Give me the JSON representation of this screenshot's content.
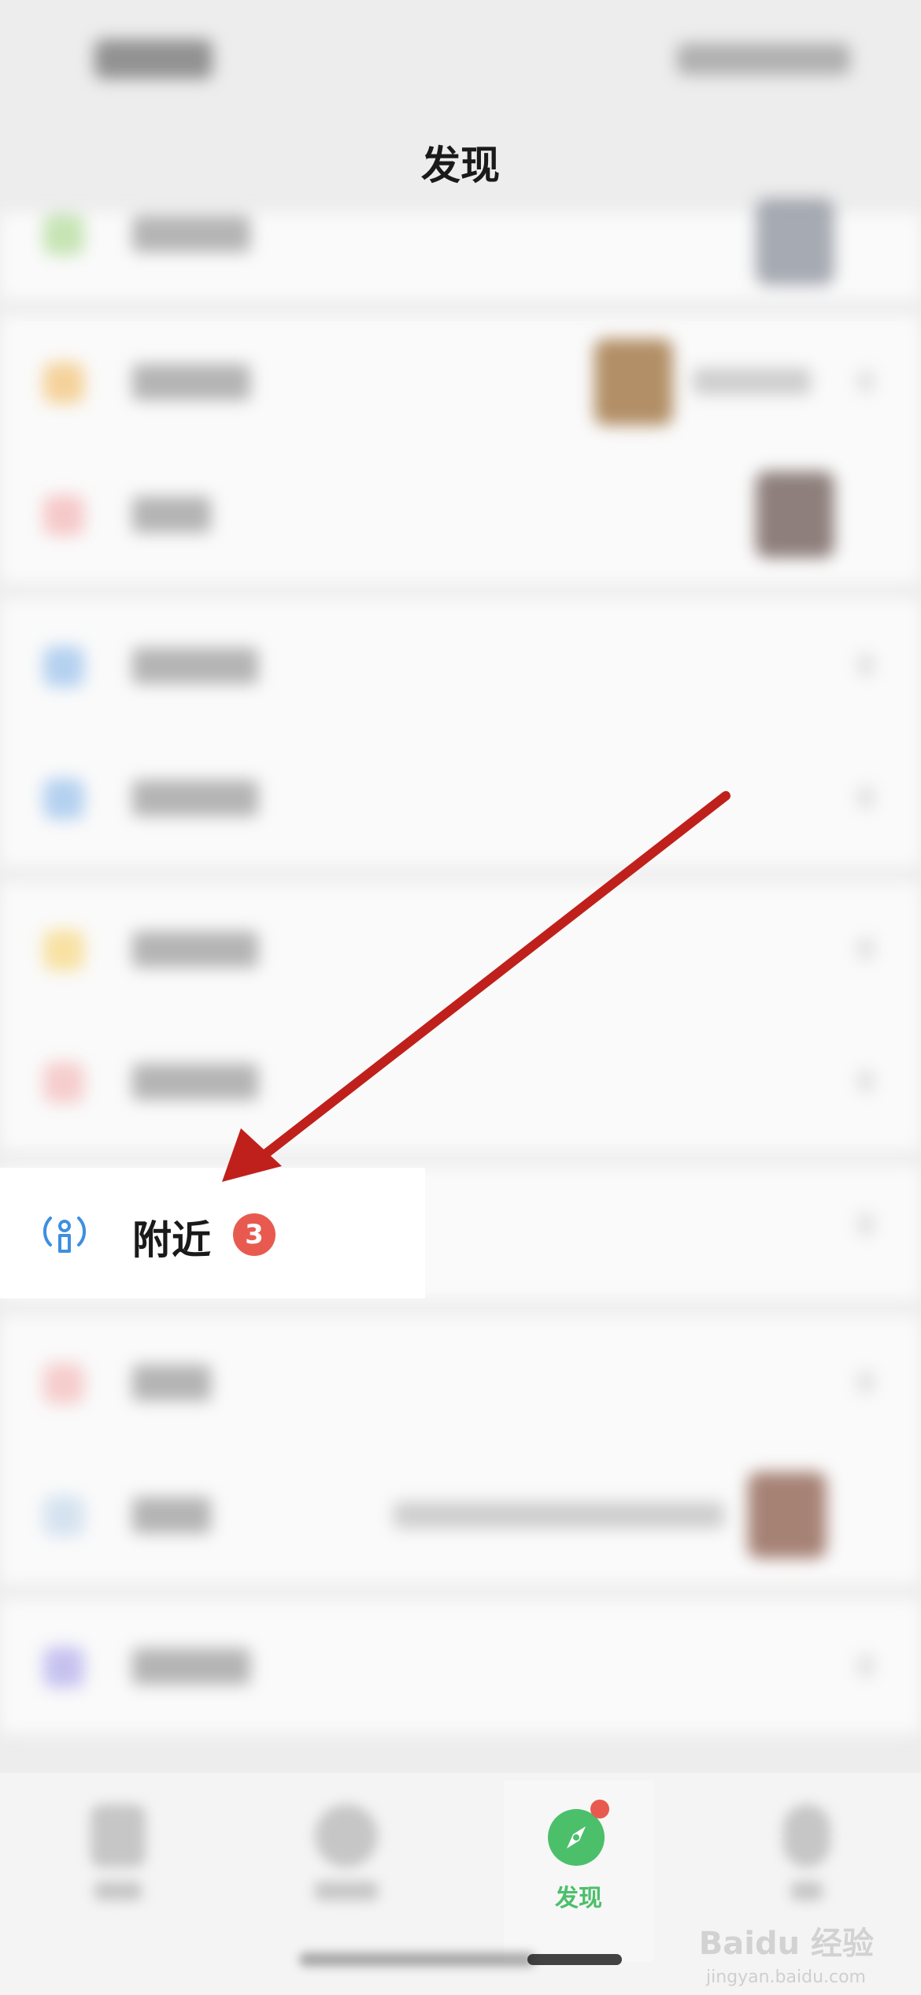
{
  "header": {
    "title": "发现"
  },
  "highlighted_item": {
    "label": "附近",
    "badge": "3"
  },
  "tab_bar": {
    "active_label": "发现"
  },
  "watermark": {
    "brand": "Baidu 经验",
    "site": "jingyan.baidu.com"
  },
  "colors": {
    "accent_green": "#4cbf6b",
    "badge_red": "#e85a4f",
    "arrow_red": "#c0201b"
  }
}
